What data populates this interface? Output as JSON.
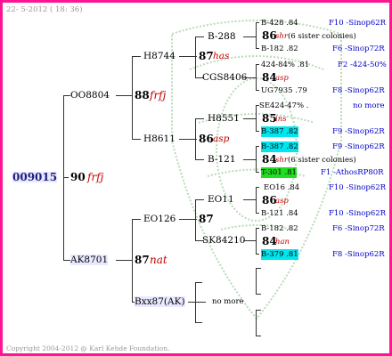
{
  "header": {
    "date": "22- 5-2012 ( 18: 36)"
  },
  "footer": {
    "copyright": "Copyright 2004-2012 @ Karl Kehde Foundation."
  },
  "root": {
    "id": "009015",
    "year": "90",
    "breed": "frfj"
  },
  "gen2": [
    {
      "id": "OO8804"
    },
    {
      "id": "AK8701"
    }
  ],
  "gen3": [
    {
      "year": "88",
      "breed": "frfj"
    },
    {
      "year": "87",
      "breed": "nat"
    }
  ],
  "gen4": [
    {
      "id": "H8744"
    },
    {
      "id": "H8611"
    },
    {
      "id": "EO126"
    },
    {
      "id": "Bxx87(AK)"
    }
  ],
  "gen5": [
    {
      "year": "87",
      "breed": "has"
    },
    {
      "year": "86",
      "breed": "asp"
    },
    {
      "year": "87",
      "breed": ""
    },
    {
      "text": "no more"
    }
  ],
  "gen6": [
    {
      "id": "B-288"
    },
    {
      "id": "CGS8406"
    },
    {
      "id": "H8551"
    },
    {
      "id": "B-121"
    },
    {
      "id": "EO11"
    },
    {
      "id": "SK84210"
    }
  ],
  "gen7": [
    {
      "code": "B-428 .84",
      "ref": "F10 -Sinop62R"
    },
    {
      "year": "86",
      "breed": "shr",
      "note": "(6 sister colonies)"
    },
    {
      "code": "B-182 .82",
      "ref": "F6 -Sinop72R"
    },
    {
      "code": "424-84% .81",
      "ref": "F2 -424-50%"
    },
    {
      "year": "84",
      "breed": "asp"
    },
    {
      "code": "UG7935 .79",
      "ref": "F8 -Sinop62R"
    },
    {
      "code": "SE424-47% .",
      "ref": "no more"
    },
    {
      "year": "85",
      "breed": "ins"
    },
    {
      "code": "B-387 .82",
      "ref": "F9 -Sinop62R"
    },
    {
      "code": "B-387 .82",
      "ref": "F9 -Sinop62R"
    },
    {
      "year": "84",
      "breed": "shr",
      "note": "(6 sister colonies)"
    },
    {
      "code": "T-301 .81",
      "ref": "F1 -AthosRP80R"
    },
    {
      "code": "EO16 .84",
      "ref": "F10 -Sinop62R"
    },
    {
      "year": "86",
      "breed": "asp"
    },
    {
      "code": "B-121 .84",
      "ref": "F10 -Sinop62R"
    },
    {
      "code": "B-182 .82",
      "ref": "F6 -Sinop72R"
    },
    {
      "year": "84",
      "breed": "han"
    },
    {
      "code": "B-379 .81",
      "ref": "F8 -Sinop62R"
    }
  ],
  "colors": {
    "frame": "#ff1493",
    "lineage": "#0000cc",
    "breed": "#c00000",
    "highlight_cyan": "#00e5ee",
    "highlight_green": "#22dd22"
  }
}
